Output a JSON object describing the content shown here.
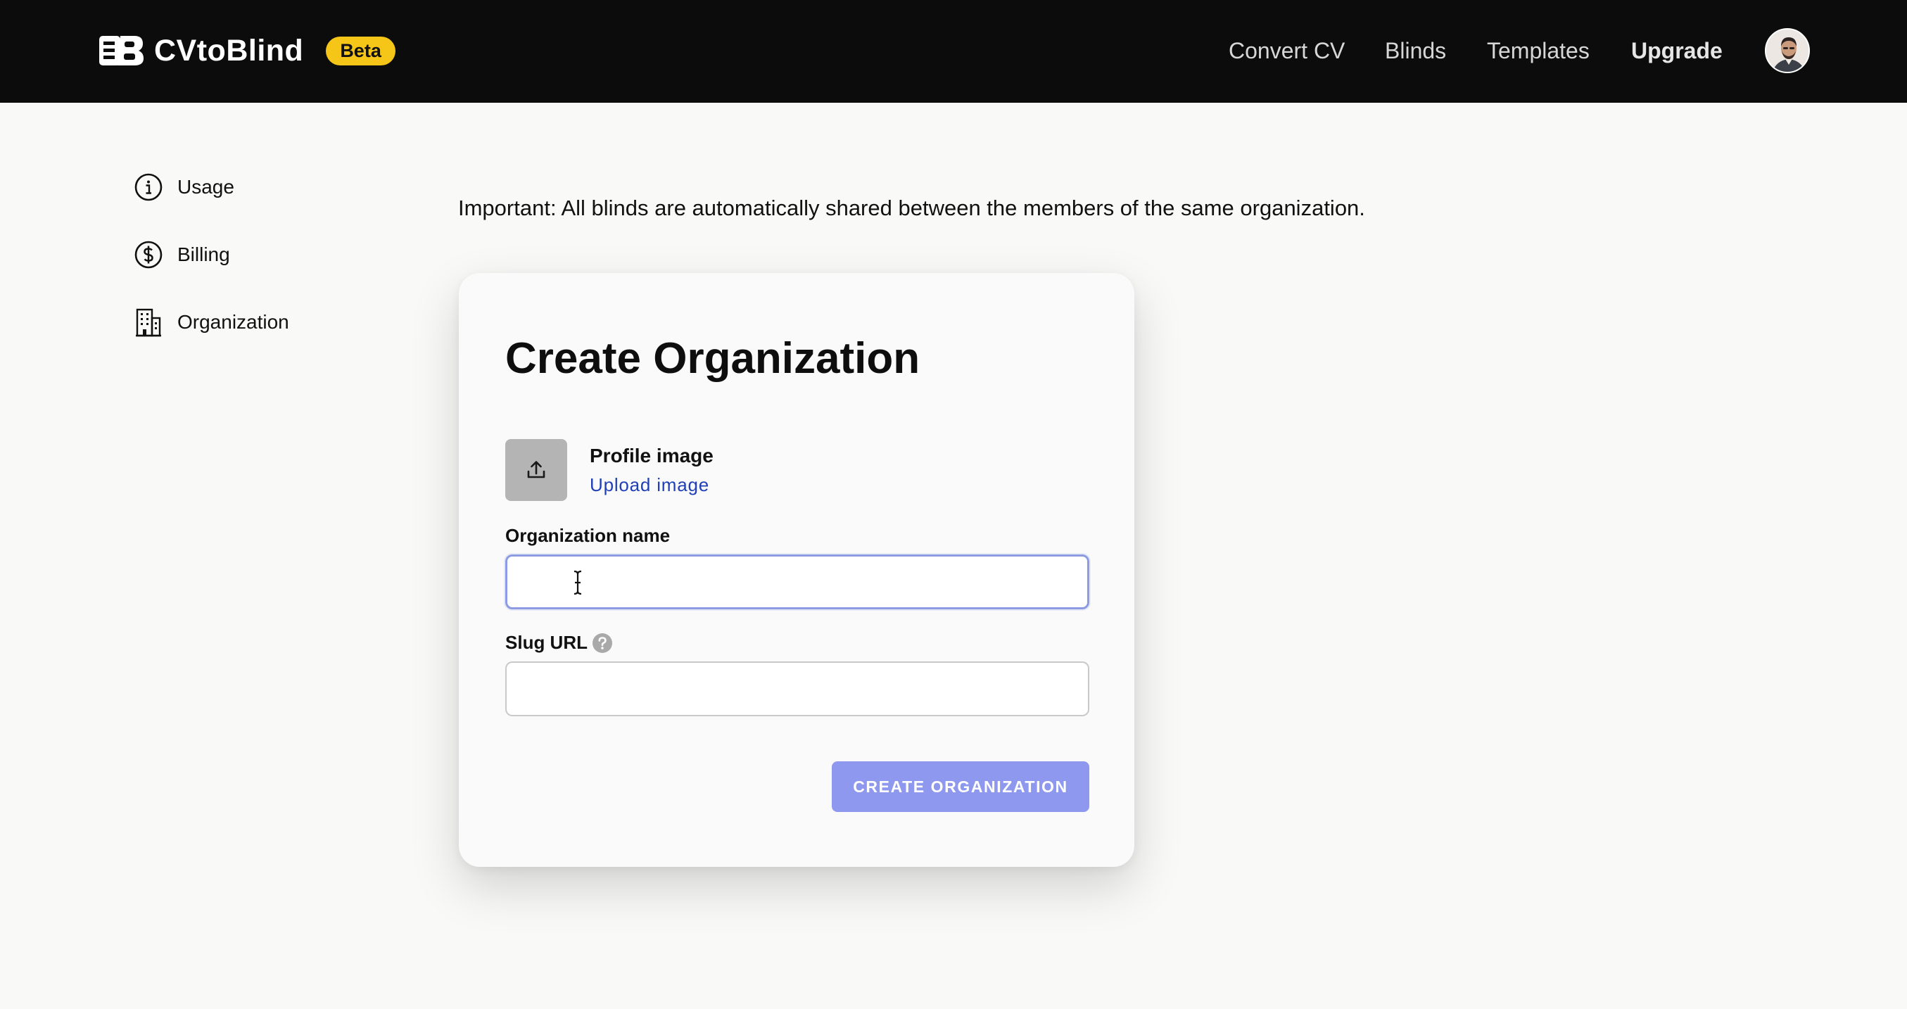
{
  "header": {
    "brand_name": "CVtoBlind",
    "badge": "Beta",
    "nav": [
      {
        "label": "Convert CV"
      },
      {
        "label": "Blinds"
      },
      {
        "label": "Templates"
      },
      {
        "label": "Upgrade"
      }
    ],
    "avatar_icon": "user-avatar"
  },
  "sidebar": {
    "items": [
      {
        "label": "Usage",
        "icon": "info-circle-icon"
      },
      {
        "label": "Billing",
        "icon": "dollar-circle-icon"
      },
      {
        "label": "Organization",
        "icon": "building-icon"
      }
    ]
  },
  "main": {
    "notice": "Important: All blinds are automatically shared between the members of the same organization.",
    "form": {
      "title": "Create Organization",
      "profile_image_label": "Profile image",
      "upload_link": "Upload image",
      "org_name_label": "Organization name",
      "org_name_value": "",
      "slug_label": "Slug URL",
      "slug_value": "",
      "submit_label": "CREATE ORGANIZATION"
    }
  },
  "colors": {
    "topbar": "#0c0c0c",
    "badge": "#f5c518",
    "link": "#2140b8",
    "button": "#8f98ef",
    "focus_border": "#8d9be2"
  }
}
